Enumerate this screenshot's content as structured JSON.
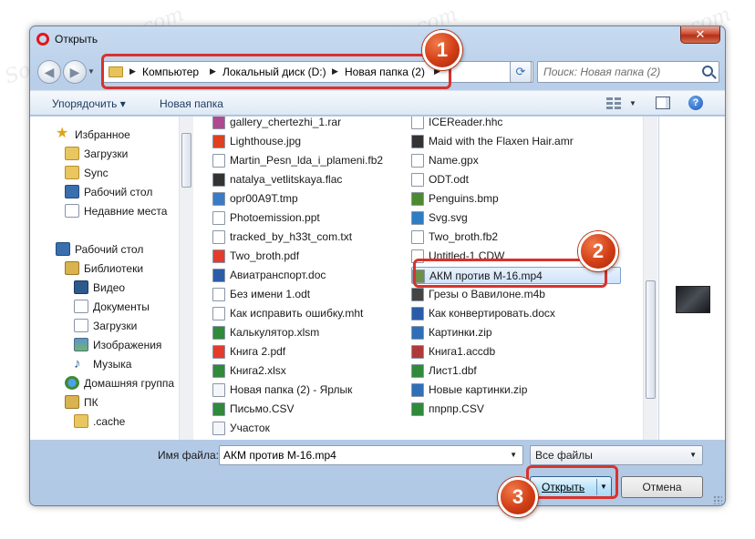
{
  "window": {
    "title": "Открыть",
    "close": "✕"
  },
  "nav": {
    "back": "◀",
    "forward": "▶",
    "breadcrumb": [
      "Компьютер",
      "Локальный диск (D:)",
      "Новая папка (2)"
    ],
    "search_placeholder": "Поиск: Новая папка (2)"
  },
  "toolbar": {
    "organize": "Упорядочить ▾",
    "new_folder": "Новая папка"
  },
  "sidebar": {
    "favorites": {
      "label": "Избранное",
      "items": [
        "Загрузки",
        "Sync",
        "Рабочий стол",
        "Недавние места"
      ]
    },
    "desktop": "Рабочий стол",
    "libraries": {
      "label": "Библиотеки",
      "items": [
        "Видео",
        "Документы",
        "Загрузки",
        "Изображения",
        "Музыка"
      ]
    },
    "homegroup": "Домашняя группа",
    "pc": "ПК",
    "pc_items": [
      ".cache"
    ]
  },
  "files": {
    "col1": [
      "gallery_chertezhi_1.rar",
      "Lighthouse.jpg",
      "Martin_Pesn_lda_i_plameni.fb2",
      "natalya_vetlitskaya.flac",
      "opr00A9T.tmp",
      "Photoemission.ppt",
      "tracked_by_h33t_com.txt",
      "Two_broth.pdf",
      "Авиатранспорт.doc",
      "Без имени 1.odt",
      "Как исправить ошибку.mht",
      "Калькулятор.xlsm",
      "Книга 2.pdf",
      "Книга2.xlsx",
      "Новая папка (2) - Ярлык",
      "Письмо.CSV",
      "Участок"
    ],
    "col2": [
      "ICEReader.hhc",
      "Maid with the Flaxen Hair.amr",
      "Name.gpx",
      "ODT.odt",
      "Penguins.bmp",
      "Svg.svg",
      "Two_broth.fb2",
      "Untitled-1.CDW",
      "АКМ против М-16.mp4",
      "Грезы о Вавилоне.m4b",
      "Как конвертировать.docx",
      "Картинки.zip",
      "Книга1.accdb",
      "Лист1.dbf",
      "Новые картинки.zip",
      "ппрпр.CSV"
    ],
    "selected": "АКМ против М-16.mp4"
  },
  "bottom": {
    "filename_label": "Имя файла:",
    "filename_value": "АКМ против М-16.mp4",
    "filetype": "Все файлы",
    "open": "Открыть",
    "cancel": "Отмена"
  },
  "annotations": {
    "step1": "1",
    "step2": "2",
    "step3": "3",
    "color": "#d8322c"
  },
  "watermark": "Sovingpersoir.com"
}
